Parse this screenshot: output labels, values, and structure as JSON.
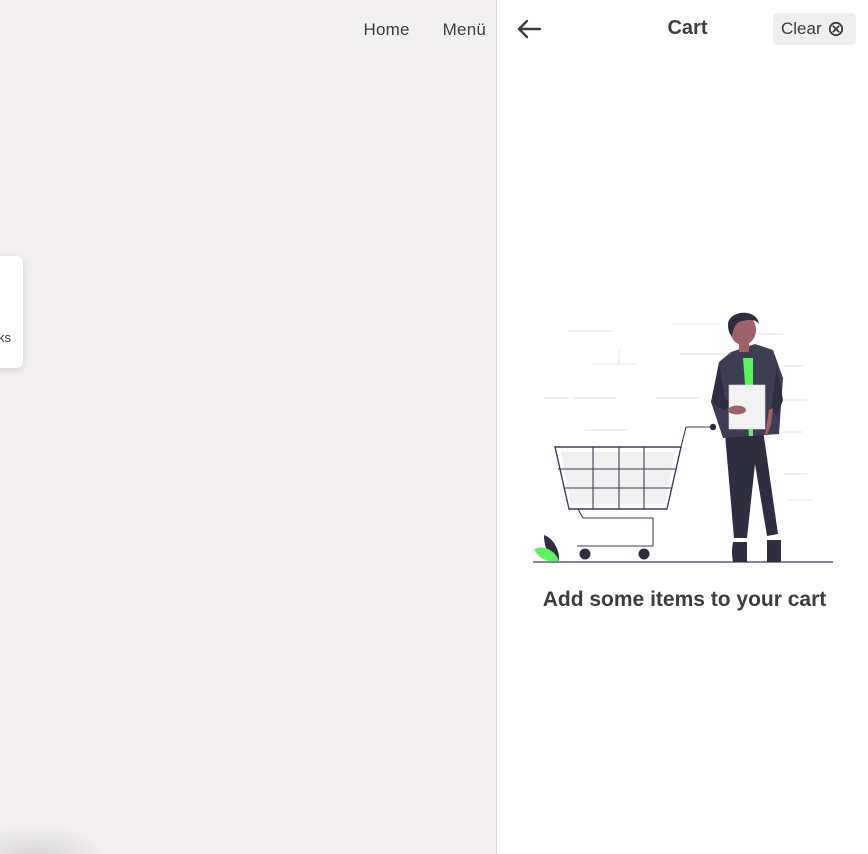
{
  "nav": {
    "home_label": "Home",
    "menu_label": "Menü"
  },
  "background_card": {
    "label_fragment": "ks"
  },
  "cart": {
    "title": "Cart",
    "clear_label": "Clear",
    "empty_message": "Add some items to your cart",
    "back_icon": "arrow-left-icon",
    "clear_icon": "clear-circle-icon",
    "illustration": "empty-cart-illustration"
  },
  "colors": {
    "page_background": "#f2f0f1",
    "panel_background": "#ffffff",
    "text": "#3d3d3d",
    "accent_green": "#5cf45e",
    "figure_dark": "#2f2e41"
  }
}
